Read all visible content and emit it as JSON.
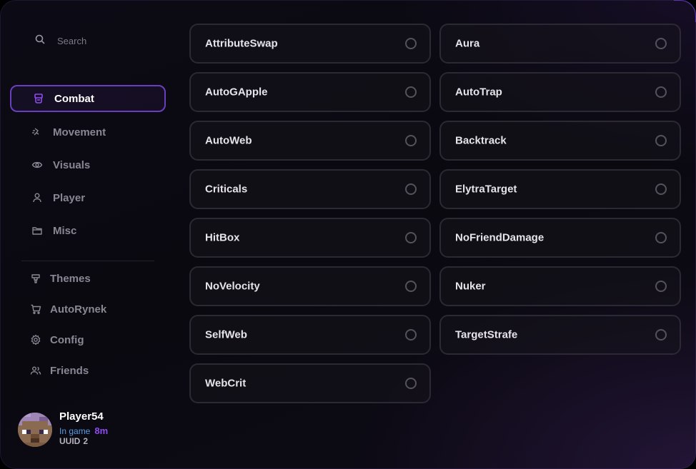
{
  "search": {
    "placeholder": "Search"
  },
  "nav": [
    {
      "label": "Combat",
      "icon": "sword-icon",
      "active": true
    },
    {
      "label": "Movement",
      "icon": "run-icon",
      "active": false
    },
    {
      "label": "Visuals",
      "icon": "eye-icon",
      "active": false
    },
    {
      "label": "Player",
      "icon": "person-icon",
      "active": false
    },
    {
      "label": "Misc",
      "icon": "folder-icon",
      "active": false
    }
  ],
  "secondary": [
    {
      "label": "Themes",
      "icon": "brush-icon"
    },
    {
      "label": "AutoRynek",
      "icon": "cart-icon"
    },
    {
      "label": "Config",
      "icon": "gear-icon"
    },
    {
      "label": "Friends",
      "icon": "users-icon"
    }
  ],
  "profile": {
    "name": "Player54",
    "status": "In game",
    "time": "8m",
    "uuid_label": "UUID",
    "uuid_value": "2"
  },
  "modules": [
    {
      "name": "AttributeSwap",
      "enabled": false
    },
    {
      "name": "Aura",
      "enabled": false
    },
    {
      "name": "AutoGApple",
      "enabled": false
    },
    {
      "name": "AutoTrap",
      "enabled": false
    },
    {
      "name": "AutoWeb",
      "enabled": false
    },
    {
      "name": "Backtrack",
      "enabled": false
    },
    {
      "name": "Criticals",
      "enabled": false
    },
    {
      "name": "ElytraTarget",
      "enabled": false
    },
    {
      "name": "HitBox",
      "enabled": false
    },
    {
      "name": "NoFriendDamage",
      "enabled": false
    },
    {
      "name": "NoVelocity",
      "enabled": false
    },
    {
      "name": "Nuker",
      "enabled": false
    },
    {
      "name": "SelfWeb",
      "enabled": false
    },
    {
      "name": "TargetStrafe",
      "enabled": false
    },
    {
      "name": "WebCrit",
      "enabled": false
    }
  ],
  "colors": {
    "accent": "#6a3fbf",
    "time": "#8f4bf0",
    "status": "#5b9be0"
  }
}
